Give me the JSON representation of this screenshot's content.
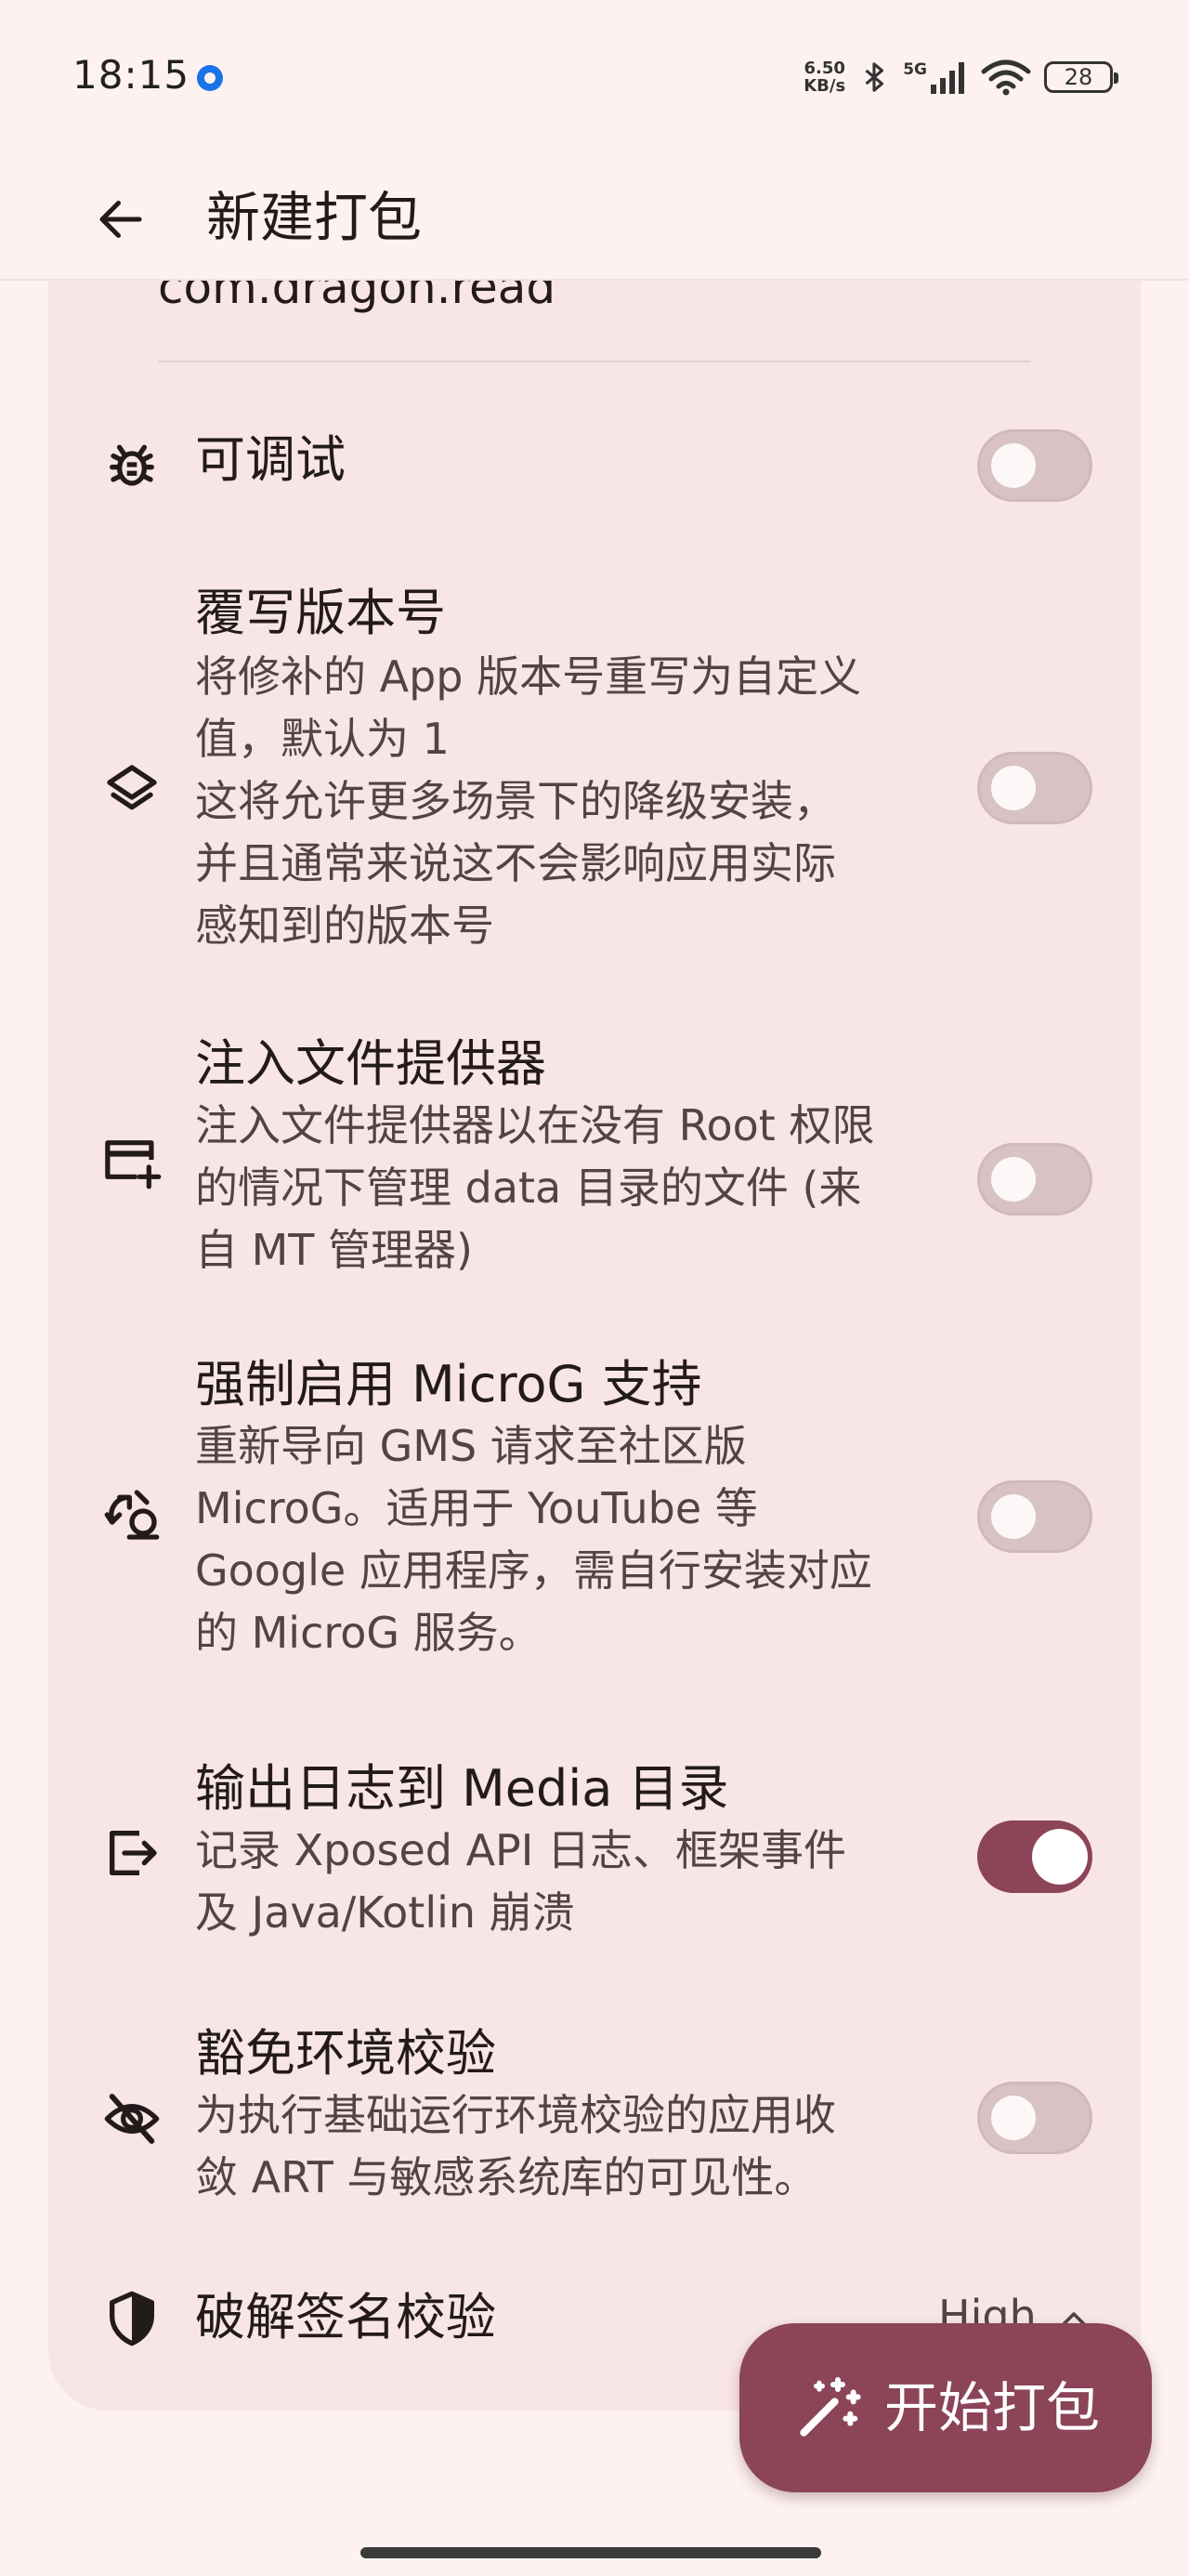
{
  "status_bar": {
    "time": "18:15",
    "net_speed_value": "6.50",
    "net_speed_unit": "KB/s",
    "network_type": "5G",
    "battery": "28"
  },
  "app_bar": {
    "title": "新建打包"
  },
  "package_name": "com.dragon.read",
  "options": {
    "debuggable": {
      "title": "可调试",
      "enabled": false
    },
    "override_version": {
      "title": "覆写版本号",
      "description": "将修补的 App 版本号重写为自定义\n值，默认为 1\n这将允许更多场景下的降级安装，\n并且通常来说这不会影响应用实际\n感知到的版本号",
      "enabled": false
    },
    "inject_provider": {
      "title": "注入文件提供器",
      "description": "注入文件提供器以在没有 Root 权限\n的情况下管理 data 目录的文件 (来\n自 MT 管理器)",
      "enabled": false
    },
    "microg": {
      "title": "强制启用 MicroG 支持",
      "description": "重新导向 GMS 请求至社区版\nMicroG。适用于 YouTube 等\nGoogle 应用程序，需自行安装对应\n的 MicroG 服务。",
      "enabled": false
    },
    "log_to_media": {
      "title": "输出日志到 Media 目录",
      "description": "记录 Xposed API 日志、框架事件\n及 Java/Kotlin 崩溃",
      "enabled": true
    },
    "env_check": {
      "title": "豁免环境校验",
      "description": "为执行基础运行环境校验的应用收\n敛 ART 与敏感系统库的可见性。",
      "enabled": false
    },
    "signature_bypass": {
      "title": "破解签名校验",
      "level": "High"
    }
  },
  "fab": {
    "label": "开始打包"
  },
  "colors": {
    "background": "#fdf2f0",
    "card": "#f8e6e6",
    "accent": "#8b4458",
    "toggle_off": "#d8c2c4"
  }
}
